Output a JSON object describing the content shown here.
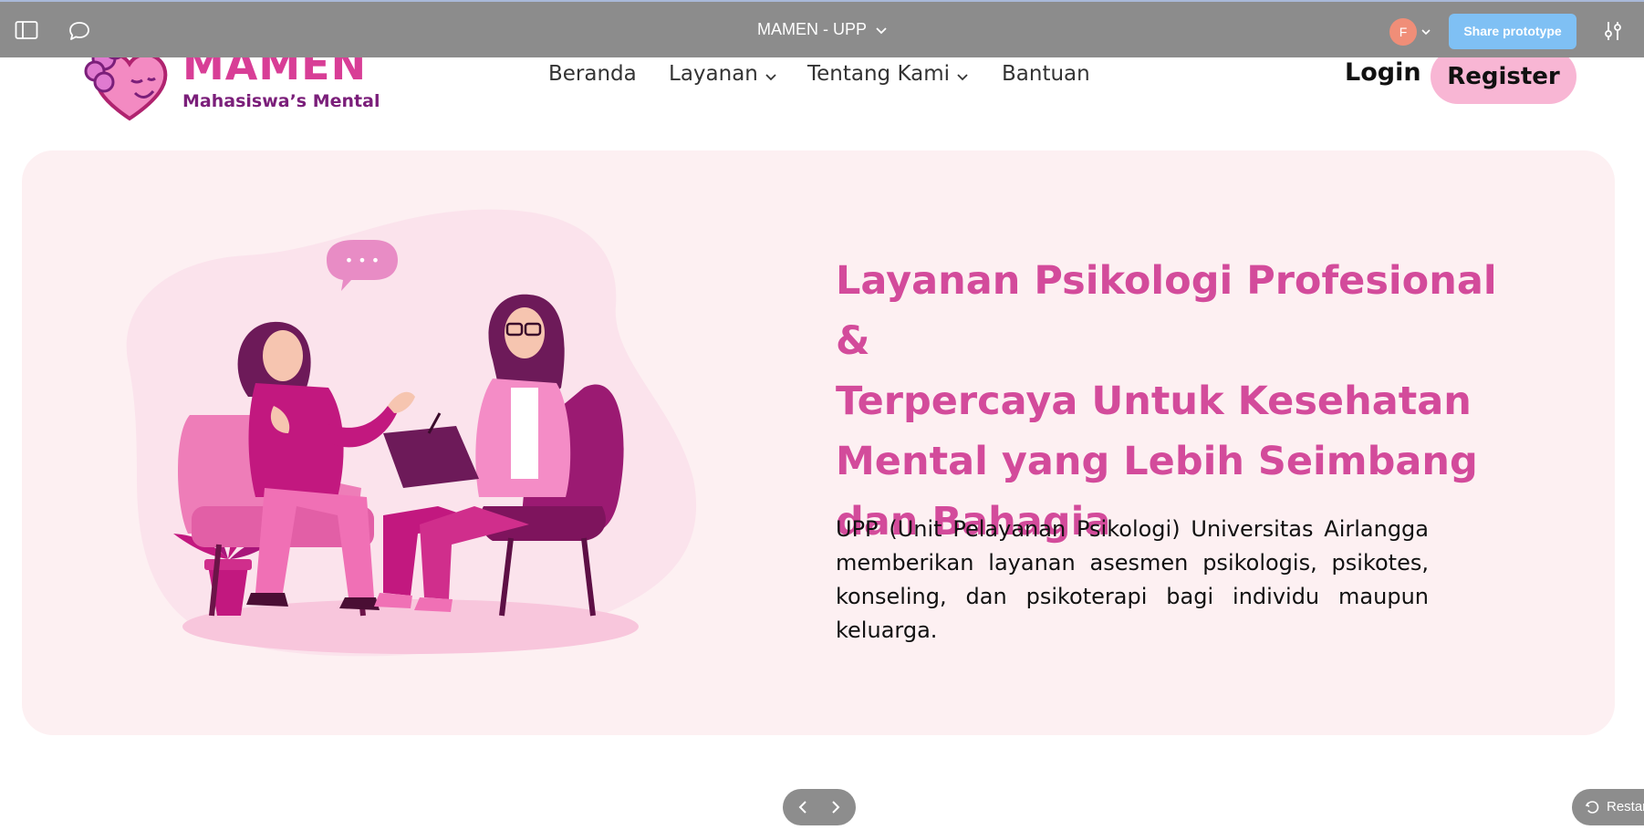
{
  "proto_bar": {
    "title": "MAMEN - UPP",
    "avatar_initial": "F",
    "share_label": "Share prototype",
    "icons": [
      "sidebar-toggle-icon",
      "comment-icon",
      "chevron-down-icon",
      "settings-sliders-icon"
    ]
  },
  "site": {
    "logo": {
      "word": "MAMEN",
      "tagline": "Mahasiswa’s Mental"
    },
    "nav": [
      {
        "label": "Beranda"
      },
      {
        "label": "Layanan"
      },
      {
        "label": "Tentang Kami"
      },
      {
        "label": "Bantuan"
      }
    ],
    "login_label": "Login",
    "register_label": "Register"
  },
  "hero": {
    "title_lines": [
      "Layanan Psikologi Profesional &",
      "Terpercaya Untuk Kesehatan",
      "Mental yang Lebih Seimbang",
      "dan Bahagia"
    ],
    "description": "UPP (Unit Pelayanan Psikologi) Universitas Airlangga memberikan layanan asesmen  psikologis, psikotes, konseling,  dan psikoterapi bagi individu maupun keluarga.",
    "speech_bubble": "• • •"
  },
  "controls": {
    "restart_label": "Restar"
  },
  "colors": {
    "brand_pink": "#d83e96",
    "brand_purple": "#7b1f7a",
    "hero_bg": "#fdf0f2",
    "register_bg": "#f8b6d4",
    "share_btn": "#7fc0f4"
  }
}
